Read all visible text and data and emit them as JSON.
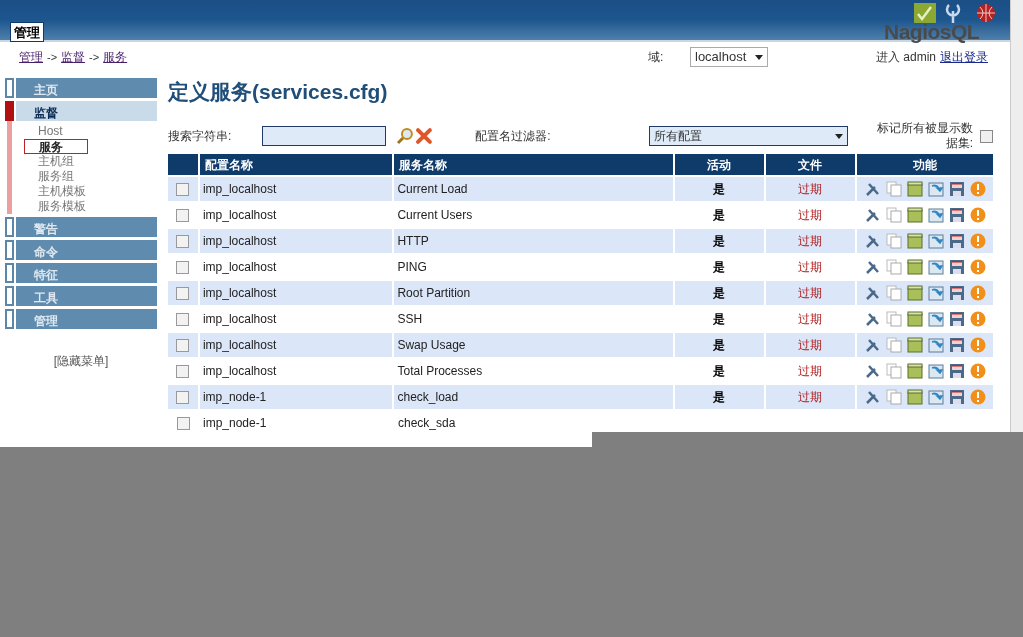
{
  "header": {
    "tab": "管理",
    "logo": "NagiosQL"
  },
  "breadcrumb": [
    "管理",
    "监督",
    "服务"
  ],
  "breadcrumb_separator": "->",
  "domain": {
    "label": "域:",
    "value": "localhost"
  },
  "login": {
    "text": "进入 admin",
    "logout": "退出登录"
  },
  "sidebar": {
    "items": [
      {
        "label": "主页",
        "selected": false
      },
      {
        "label": "监督",
        "selected": true,
        "children": [
          {
            "label": "Host",
            "selected": false
          },
          {
            "label": "服务",
            "selected": true
          },
          {
            "label": "主机组",
            "selected": false
          },
          {
            "label": "服务组",
            "selected": false
          },
          {
            "label": "主机模板",
            "selected": false
          },
          {
            "label": "服务模板",
            "selected": false
          }
        ]
      },
      {
        "label": "警告",
        "selected": false
      },
      {
        "label": "命令",
        "selected": false
      },
      {
        "label": "特征",
        "selected": false
      },
      {
        "label": "工具",
        "selected": false
      },
      {
        "label": "管理",
        "selected": false
      }
    ],
    "hide_menu": "[隐藏菜单]"
  },
  "title": "定义服务(services.cfg)",
  "search": {
    "label": "搜索字符串:"
  },
  "filter": {
    "label": "配置名过滤器:",
    "value": "所有配置"
  },
  "mark_all": {
    "label": "标记所有被显示数据集:",
    "checked": false
  },
  "table": {
    "columns": [
      "配置名称",
      "服务名称",
      "活动",
      "文件",
      "功能"
    ],
    "rows": [
      {
        "checked": false,
        "config": "imp_localhost",
        "service": "Current Load",
        "active": "是",
        "file": "过期"
      },
      {
        "checked": false,
        "config": "imp_localhost",
        "service": "Current Users",
        "active": "是",
        "file": "过期"
      },
      {
        "checked": false,
        "config": "imp_localhost",
        "service": "HTTP",
        "active": "是",
        "file": "过期"
      },
      {
        "checked": false,
        "config": "imp_localhost",
        "service": "PING",
        "active": "是",
        "file": "过期"
      },
      {
        "checked": false,
        "config": "imp_localhost",
        "service": "Root Partition",
        "active": "是",
        "file": "过期"
      },
      {
        "checked": false,
        "config": "imp_localhost",
        "service": "SSH",
        "active": "是",
        "file": "过期"
      },
      {
        "checked": false,
        "config": "imp_localhost",
        "service": "Swap Usage",
        "active": "是",
        "file": "过期"
      },
      {
        "checked": false,
        "config": "imp_localhost",
        "service": "Total Processes",
        "active": "是",
        "file": "过期"
      },
      {
        "checked": false,
        "config": "imp_node-1",
        "service": "check_load",
        "active": "是",
        "file": "过期"
      },
      {
        "checked": false,
        "config": "imp_node-1",
        "service": "check_sda"
      }
    ]
  }
}
